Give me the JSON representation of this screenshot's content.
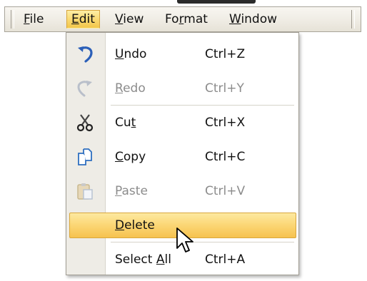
{
  "menubar": {
    "menus": [
      {
        "label_pre": "",
        "label_ul": "F",
        "label_post": "ile",
        "active": false
      },
      {
        "label_pre": "",
        "label_ul": "E",
        "label_post": "dit",
        "active": true
      },
      {
        "label_pre": "",
        "label_ul": "V",
        "label_post": "iew",
        "active": false
      },
      {
        "label_pre": "Fo",
        "label_ul": "r",
        "label_post": "mat",
        "active": false
      },
      {
        "label_pre": "",
        "label_ul": "W",
        "label_post": "indow",
        "active": false
      }
    ]
  },
  "edit_menu": {
    "items": [
      {
        "icon": "undo-icon",
        "label_pre": "",
        "label_ul": "U",
        "label_post": "ndo",
        "shortcut": "Ctrl+Z",
        "enabled": true
      },
      {
        "icon": "redo-icon",
        "label_pre": "",
        "label_ul": "R",
        "label_post": "edo",
        "shortcut": "Ctrl+Y",
        "enabled": false
      },
      {
        "icon": "scissors-icon",
        "label_pre": "Cu",
        "label_ul": "t",
        "label_post": "",
        "shortcut": "Ctrl+X",
        "enabled": true
      },
      {
        "icon": "copy-icon",
        "label_pre": "",
        "label_ul": "C",
        "label_post": "opy",
        "shortcut": "Ctrl+C",
        "enabled": true
      },
      {
        "icon": "paste-icon",
        "label_pre": "",
        "label_ul": "P",
        "label_post": "aste",
        "shortcut": "Ctrl+V",
        "enabled": false
      },
      {
        "icon": "",
        "label_pre": "",
        "label_ul": "D",
        "label_post": "elete",
        "shortcut": "",
        "enabled": true,
        "highlighted": true
      },
      {
        "icon": "",
        "label_pre": "Select ",
        "label_ul": "A",
        "label_post": "ll",
        "shortcut": "Ctrl+A",
        "enabled": true
      }
    ]
  },
  "colors": {
    "highlight": "#f9d86f",
    "disabled_text": "#8c8c8c",
    "undo_blue": "#2b5fb8"
  }
}
